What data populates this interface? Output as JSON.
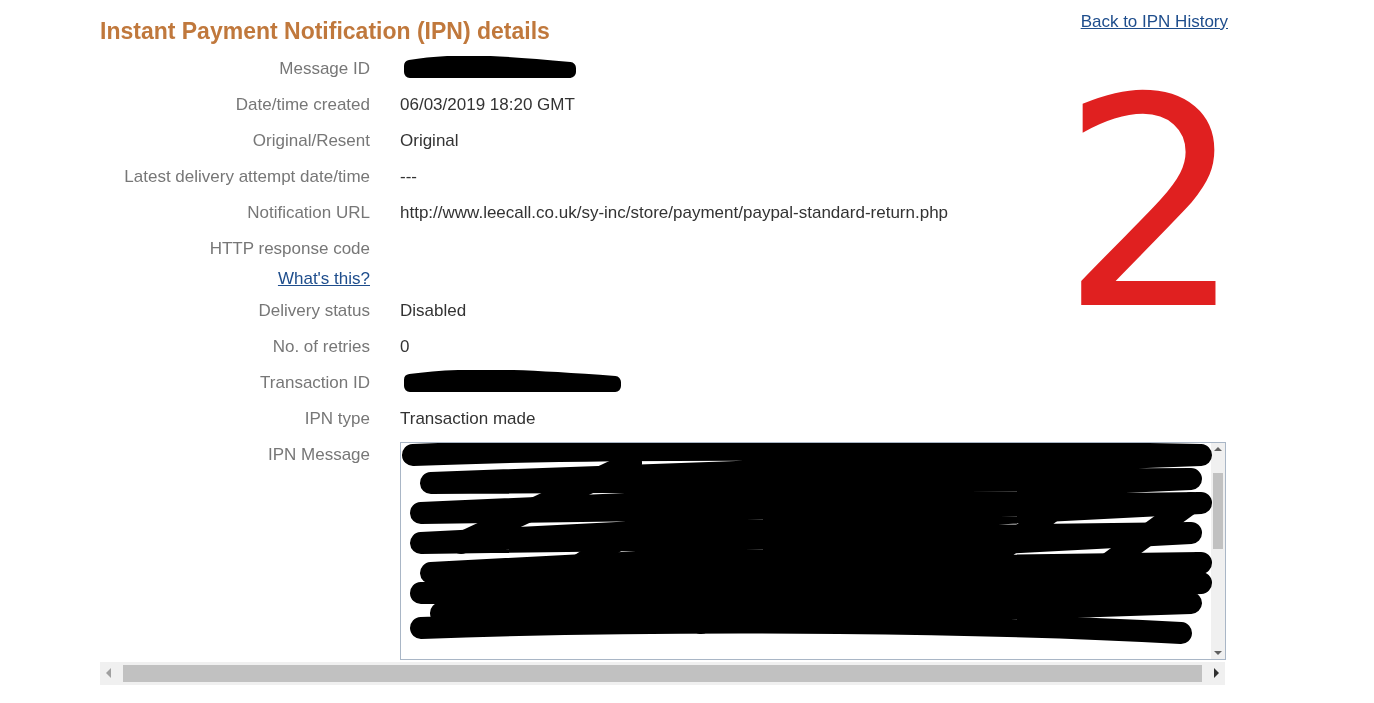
{
  "title": "Instant Payment Notification (IPN) details",
  "back_link": "Back to IPN History",
  "annotation": "2",
  "fields": [
    {
      "label": "Message ID",
      "kind": "redacted"
    },
    {
      "label": "Date/time created",
      "kind": "text",
      "value": "06/03/2019 18:20 GMT"
    },
    {
      "label": "Original/Resent",
      "kind": "text",
      "value": "Original"
    },
    {
      "label": "Latest delivery attempt date/time",
      "kind": "text",
      "value": "---"
    },
    {
      "label": "Notification URL",
      "kind": "text",
      "value": "http://www.leecall.co.uk/sy-inc/store/payment/paypal-standard-return.php"
    },
    {
      "label": "HTTP response code",
      "kind": "help",
      "link": "What's this?"
    },
    {
      "label": "Delivery status",
      "kind": "text",
      "value": "Disabled"
    },
    {
      "label": "No. of retries",
      "kind": "text",
      "value": "0"
    },
    {
      "label": "Transaction ID",
      "kind": "redacted"
    },
    {
      "label": "IPN type",
      "kind": "text",
      "value": "Transaction made"
    },
    {
      "label": "IPN Message",
      "kind": "message"
    }
  ]
}
